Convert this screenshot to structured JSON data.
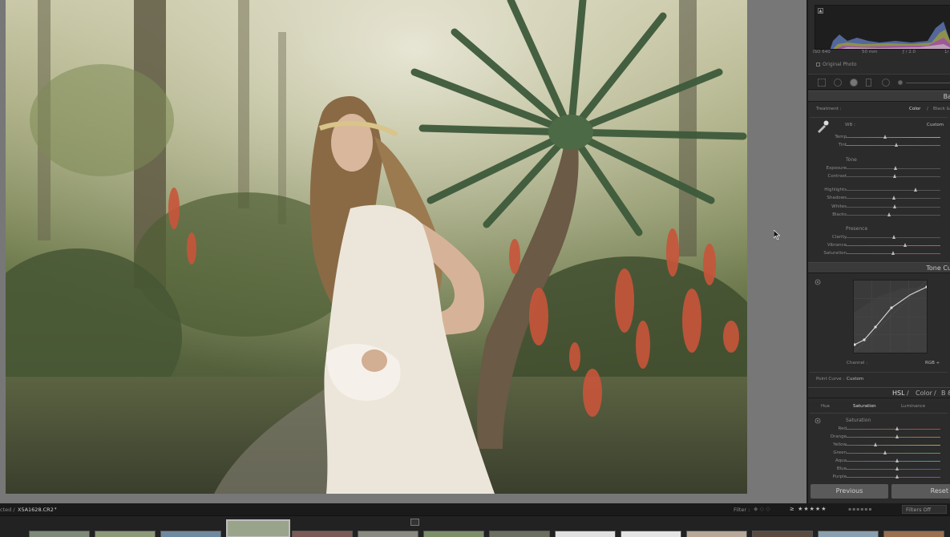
{
  "photo": {
    "description_icon": "photo-canvas"
  },
  "histogram": {
    "iso": "ISO 640",
    "focal": "50 mm",
    "aperture": "ƒ / 2.0",
    "shutter": "1/"
  },
  "original_photo_label": "Original Photo",
  "basic": {
    "title": "Ba",
    "treatment_label": "Treatment :",
    "color_option": "Color",
    "bw_option": "Black &",
    "wb_label": "WB :",
    "wb_value": "Custom",
    "temp": "Temp",
    "tint": "Tint",
    "tone_head": "Tone",
    "exposure": "Exposure",
    "contrast": "Contrast",
    "highlights": "Highlights",
    "shadows": "Shadows",
    "whites": "Whites",
    "blacks": "Blacks",
    "presence_head": "Presence",
    "clarity": "Clarity",
    "vibrance": "Vibrance",
    "saturation": "Saturation"
  },
  "levels": {
    "temp": 0.42,
    "tint": 0.54,
    "exposure": 0.53,
    "contrast": 0.52,
    "highlights": 0.74,
    "shadows": 0.51,
    "whites": 0.52,
    "blacks": 0.46,
    "clarity": 0.51,
    "vibrance": 0.63,
    "saturation": 0.5,
    "hsl_red": 0.55,
    "hsl_orange": 0.55,
    "hsl_yellow": 0.32,
    "hsl_green": 0.42,
    "hsl_aqua": 0.55,
    "hsl_blue": 0.55,
    "hsl_purple": 0.55
  },
  "tone_curve": {
    "title": "Tone Cu",
    "channel_label": "Channel :",
    "channel_value": "RGB ÷",
    "point_curve_label": "Point Curve :",
    "point_curve_value": "Custom"
  },
  "hsl": {
    "title_hsl": "HSL",
    "title_sep": "/",
    "title_color": "Color",
    "title_sep2": "/",
    "title_bw": "B &",
    "tab_hue": "Hue",
    "tab_saturation": "Saturation",
    "tab_luminance": "Luminance",
    "sub_head": "Saturation",
    "red": "Red",
    "orange": "Orange",
    "yellow": "Yellow",
    "green": "Green",
    "aqua": "Aqua",
    "blue": "Blue",
    "purple": "Purple"
  },
  "buttons": {
    "previous": "Previous",
    "reset": "Reset"
  },
  "filmstrip": {
    "selected_prefix": "cted /",
    "filename": "X5A1628.CR2",
    "filter_label": "Filter :",
    "filters_off": "Filters Off"
  }
}
